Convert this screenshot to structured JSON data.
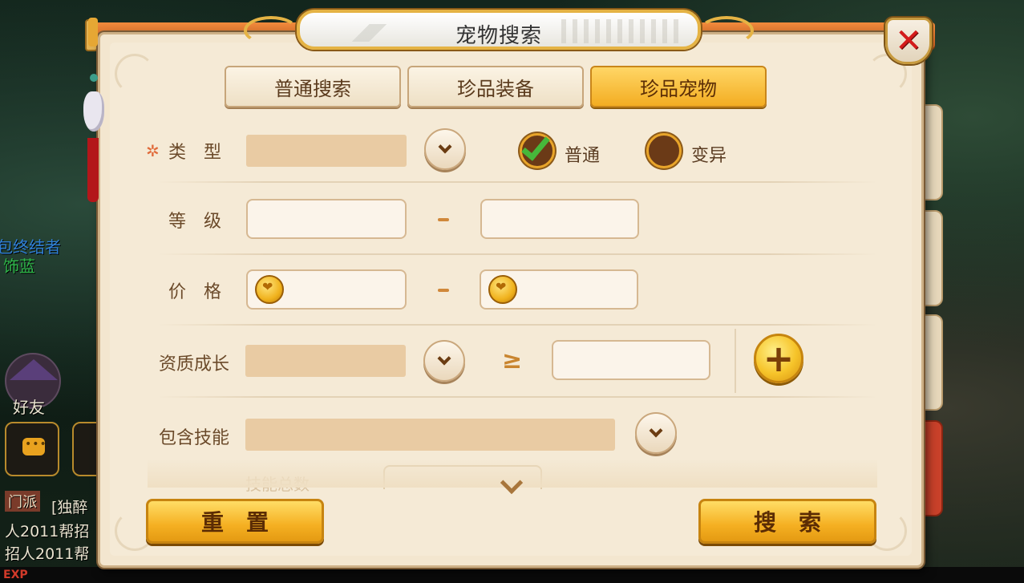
{
  "dialog": {
    "title": "宠物搜索"
  },
  "tabs": [
    {
      "label": "普通搜索",
      "active": false
    },
    {
      "label": "珍品装备",
      "active": false
    },
    {
      "label": "珍品宠物",
      "active": true
    }
  ],
  "form": {
    "type": {
      "required_mark": "✲",
      "label": "类　型",
      "value": "",
      "options": [
        {
          "label": "普通",
          "checked": true
        },
        {
          "label": "变异",
          "checked": false
        }
      ]
    },
    "level": {
      "label": "等　级",
      "min": "",
      "max": "",
      "separator": "-"
    },
    "price": {
      "label": "价　格",
      "min": "",
      "max": "",
      "separator": "-",
      "currency_icon": "gold-coin-icon"
    },
    "aptitude": {
      "label": "资质成长",
      "value": "",
      "operator": "≥",
      "threshold": ""
    },
    "skills": {
      "label": "包含技能",
      "value": ""
    },
    "skill_count": {
      "label": "技能总数",
      "operator": "≥"
    }
  },
  "buttons": {
    "reset": "重置",
    "search": "搜索"
  },
  "background_hud": {
    "line1": "包终结者",
    "line2": "饰蓝",
    "friends": "好友",
    "faction": "门派",
    "chat1": "[独醉",
    "chat2": "人2011帮招",
    "chat3": "招人2011帮",
    "exp": "EXP"
  },
  "colors": {
    "accent_gold": "#f3ad22",
    "panel_bg": "#f5ead6",
    "title_band": "#e0763a",
    "close_red": "#d41b1b",
    "check_green": "#46b83a"
  }
}
